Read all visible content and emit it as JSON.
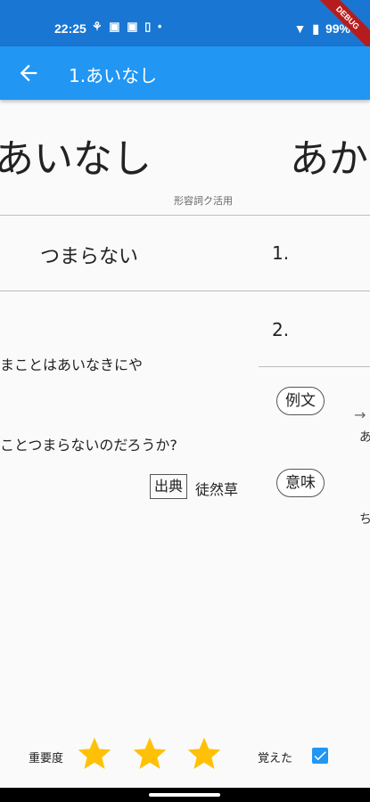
{
  "status_bar": {
    "time": "22:25",
    "notification_icons": [
      "usb-debug-icon",
      "sim-icon",
      "sim-icon",
      "sd-card-icon",
      "dot-icon"
    ],
    "battery": "99%",
    "debug_banner": "DEBUG"
  },
  "app_bar": {
    "title": "1.あいなし",
    "back_icon": "arrow-left-icon"
  },
  "left_page": {
    "word": "あいなし",
    "part_of_speech": "形容詞ク活用",
    "meaning": "つまらない",
    "example_original": "まことはあいなきにや",
    "example_translation": "ことつまらないのだろうか?",
    "source_label": "出典",
    "source": "徒然草"
  },
  "right_page": {
    "word": "あか",
    "meaning_numbers": [
      "1.",
      "2."
    ],
    "example_button": "例文",
    "meaning_button": "意味",
    "arrow": "→",
    "fragment_1": "あ",
    "fragment_2": "ち"
  },
  "bottom": {
    "importance_label": "重要度",
    "stars": 3,
    "learned_label": "覚えた",
    "learned": true
  },
  "colors": {
    "status_bar": "#1976d2",
    "app_bar": "#2196f3",
    "star": "#ffc107",
    "checkbox": "#2196f3"
  }
}
